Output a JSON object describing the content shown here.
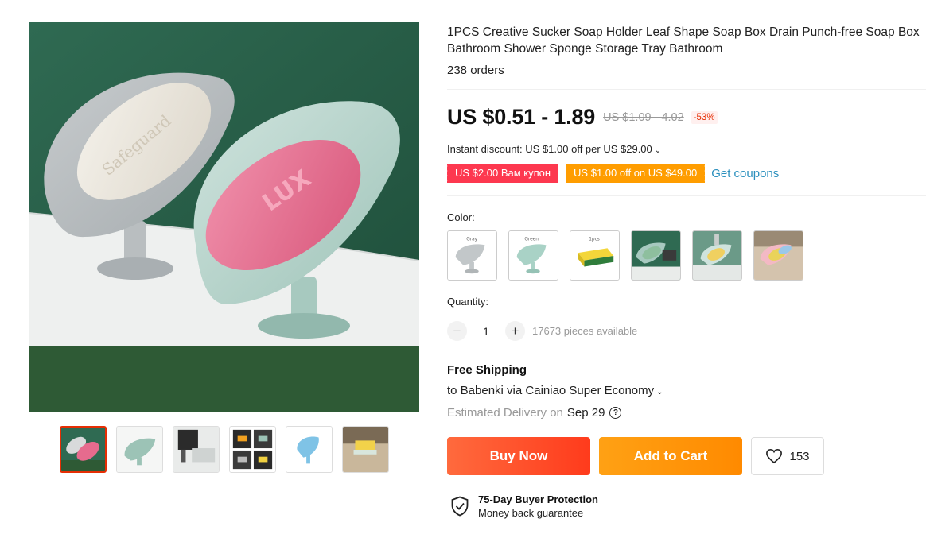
{
  "gallery": {
    "main_image_alt": "leaf-shaped soap holders with soap",
    "thumbnails": [
      {
        "icon": "thumb-soap-pair",
        "active": true
      },
      {
        "icon": "thumb-green-leaf",
        "active": false
      },
      {
        "icon": "thumb-faucet-sink",
        "active": false
      },
      {
        "icon": "thumb-color-grid",
        "active": false
      },
      {
        "icon": "thumb-blue-leaf",
        "active": false
      },
      {
        "icon": "thumb-sponge-tray",
        "active": false
      }
    ]
  },
  "product": {
    "title": "1PCS Creative Sucker Soap Holder Leaf Shape Soap Box Drain Punch-free Soap Box Bathroom Shower Sponge Storage Tray Bathroom",
    "orders": "238 orders",
    "price": "US $0.51 - 1.89",
    "original_price": "US $1.09 - 4.02",
    "discount_percent": "-53%"
  },
  "promotions": {
    "instant_discount": "Instant discount: US $1.00 off per US $29.00",
    "coupon_1": "US $2.00 Вам купон",
    "coupon_2": "US $1.00 off on US $49.00",
    "get_coupons": "Get coupons"
  },
  "color": {
    "label": "Color:",
    "options": [
      {
        "name": "Gray",
        "tag": "Gray"
      },
      {
        "name": "Green",
        "tag": "Green"
      },
      {
        "name": "sponge",
        "tag": "1pcs"
      },
      {
        "name": "photo-1",
        "tag": ""
      },
      {
        "name": "photo-2",
        "tag": ""
      },
      {
        "name": "photo-3",
        "tag": ""
      }
    ]
  },
  "quantity": {
    "label": "Quantity:",
    "value": "1",
    "available": "17673 pieces available"
  },
  "shipping": {
    "title": "Free Shipping",
    "to": "to Babenki via Cainiao Super Economy",
    "estimated_label": "Estimated Delivery on",
    "estimated_date": "Sep 29"
  },
  "actions": {
    "buy_now": "Buy Now",
    "add_to_cart": "Add to Cart",
    "wishlist_count": "153"
  },
  "protection": {
    "title": "75-Day Buyer Protection",
    "subtitle": "Money back guarantee"
  },
  "colors": {
    "price": "#111111",
    "discount_red": "#e62e04",
    "coupon_red": "#fd384f",
    "coupon_orange": "#ff9d00",
    "link_blue": "#2a8fbd",
    "buy_button": "#ff4b26",
    "cart_button": "#ff9a0a"
  }
}
